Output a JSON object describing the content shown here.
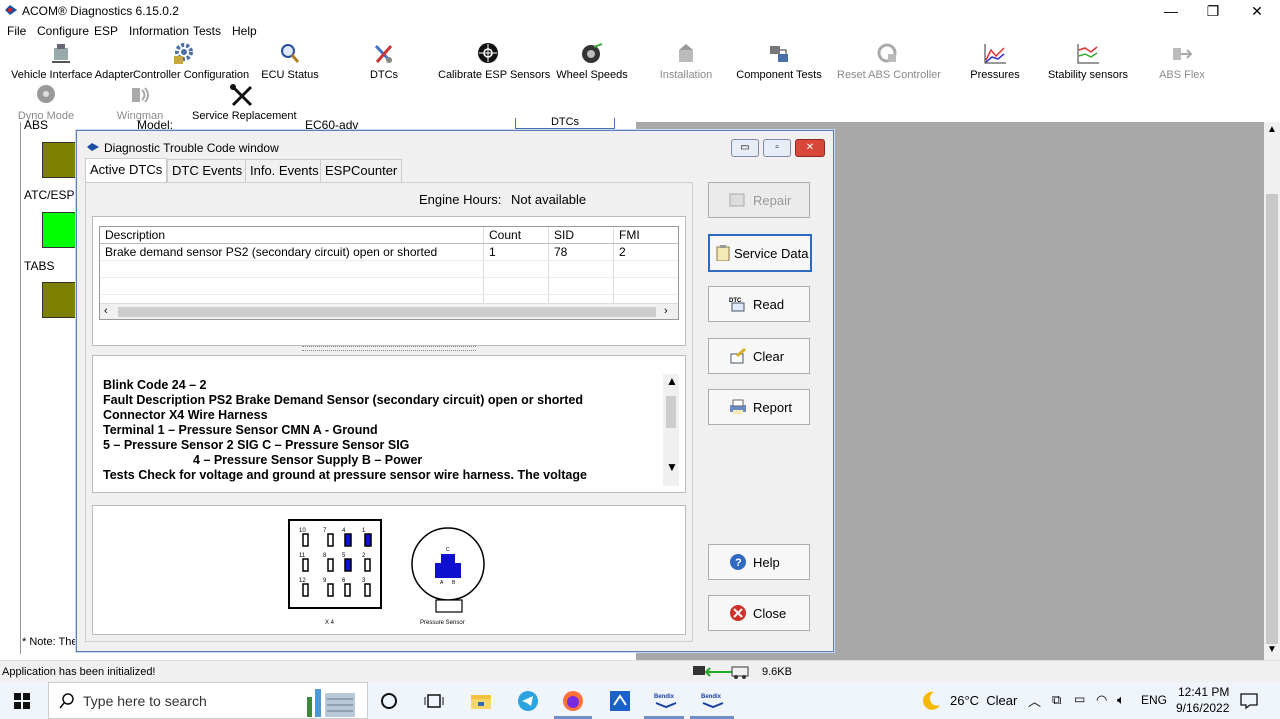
{
  "window": {
    "title": "ACOM® Diagnostics 6.15.0.2",
    "minimize": "—",
    "restore": "❐",
    "close": "✕"
  },
  "menu": [
    "File",
    "Configure",
    "ESP",
    "Information",
    "Tests",
    "Help"
  ],
  "toolbar": {
    "row1": [
      {
        "label": "Vehicle Interface Adapter",
        "icon": "adapter-icon",
        "enabled": true
      },
      {
        "label": "Controller Configuration",
        "icon": "gear-icon",
        "enabled": true
      },
      {
        "label": "ECU Status",
        "icon": "magnifier-icon",
        "enabled": true
      },
      {
        "label": "DTCs",
        "icon": "tools-icon",
        "enabled": true
      },
      {
        "label": "Calibrate ESP Sensors",
        "icon": "target-icon",
        "enabled": true
      },
      {
        "label": "Wheel Speeds",
        "icon": "wheel-icon",
        "enabled": true
      },
      {
        "label": "Installation",
        "icon": "installation-icon",
        "enabled": false
      },
      {
        "label": "Component Tests",
        "icon": "component-icon",
        "enabled": true
      },
      {
        "label": "Reset ABS Controller",
        "icon": "reset-icon",
        "enabled": false
      },
      {
        "label": "Pressures",
        "icon": "pressure-chart-icon",
        "enabled": true
      },
      {
        "label": "Stability sensors",
        "icon": "stability-chart-icon",
        "enabled": true
      },
      {
        "label": "ABS Flex",
        "icon": "flex-icon",
        "enabled": false
      }
    ],
    "row2": [
      {
        "label": "Dyno Mode",
        "icon": "dyno-icon",
        "enabled": false
      },
      {
        "label": "Wingman",
        "icon": "wingman-icon",
        "enabled": false
      },
      {
        "label": "Service Replacement",
        "icon": "wrench-screwdriver-icon",
        "enabled": true
      }
    ]
  },
  "background": {
    "labels": [
      "ABS",
      "ATC/ESP",
      "TABS"
    ],
    "model_label": "Model:",
    "model_value": "EC60-adv",
    "dtcs_btn": "DTCs",
    "note": "* Note: The",
    "box_colors": [
      "#7f7f00",
      "#00ff00",
      "#7f7f00"
    ]
  },
  "status": {
    "text": "Application has been initialized!",
    "size": "9.6KB"
  },
  "dialog": {
    "title": "Diagnostic Trouble Code window",
    "tabs": [
      "Active DTCs",
      "DTC Events",
      "Info. Events",
      "ESPCounter"
    ],
    "engine_hours_label": "Engine Hours:",
    "engine_hours_value": "Not available",
    "table": {
      "headers": [
        "Description",
        "Count",
        "SID",
        "FMI"
      ],
      "rows": [
        [
          "Brake demand sensor PS2 (secondary circuit) open or shorted",
          "1",
          "78",
          "2"
        ]
      ]
    },
    "details": [
      "Blink Code 24 – 2",
      "Fault Description PS2 Brake Demand Sensor (secondary circuit) open or shorted",
      "Connector X4 Wire Harness",
      "Terminal 1 – Pressure Sensor CMN A - Ground",
      "5 – Pressure Sensor 2 SIG C – Pressure Sensor SIG",
      "4 – Pressure Sensor Supply B – Power",
      "Tests Check for voltage and ground at pressure sensor wire harness. The voltage"
    ],
    "diagram": {
      "connector_label": "X 4",
      "sensor_label": "Pressure Sensor",
      "pins_row1": [
        "10",
        "7",
        "4",
        "1"
      ],
      "pins_row2": [
        "11",
        "8",
        "5",
        "2"
      ],
      "pins_row3": [
        "12",
        "9",
        "6",
        "3"
      ],
      "sensor_pins": [
        "C",
        "A",
        "B"
      ]
    },
    "buttons": {
      "repair": "Repair",
      "service_data": "Service Data",
      "read": "Read",
      "clear": "Clear",
      "report": "Report",
      "help": "Help",
      "close": "Close"
    }
  },
  "taskbar": {
    "search_placeholder": "Type here to search",
    "weather": "26°C  Clear",
    "lang": "ENG",
    "time": "12:41 PM",
    "date": "9/16/2022"
  }
}
